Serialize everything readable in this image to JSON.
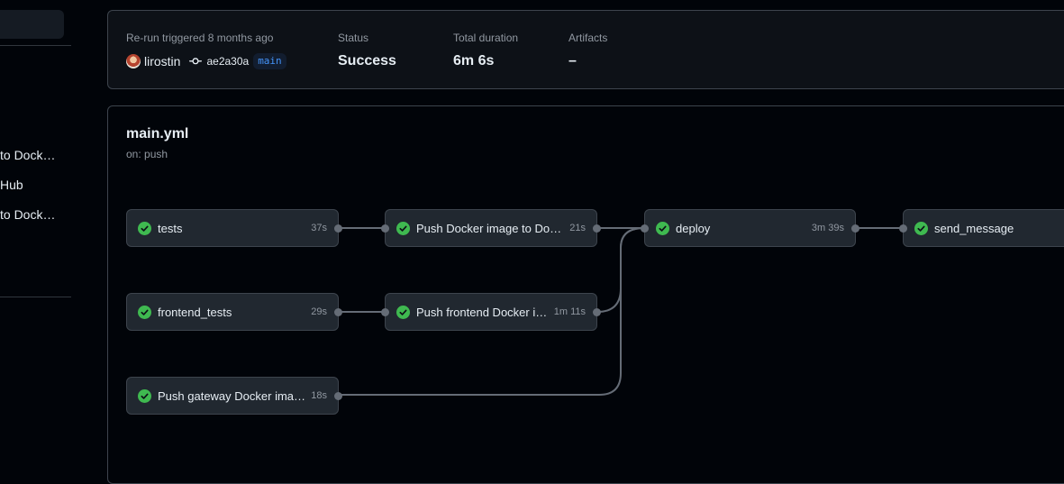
{
  "sidebar": {
    "items": [
      {
        "label": "to Dock…"
      },
      {
        "label": "Hub"
      },
      {
        "label": "to Dock…"
      }
    ]
  },
  "summary": {
    "trigger_label": "Re-run triggered 8 months ago",
    "actor": "lirostin",
    "commit": "ae2a30a",
    "branch": "main",
    "status_label": "Status",
    "status_value": "Success",
    "duration_label": "Total duration",
    "duration_value": "6m 6s",
    "artifacts_label": "Artifacts",
    "artifacts_value": "–"
  },
  "workflow": {
    "name": "main.yml",
    "trigger": "on: push",
    "jobs": [
      {
        "name": "tests",
        "duration": "37s"
      },
      {
        "name": "frontend_tests",
        "duration": "29s"
      },
      {
        "name": "Push gateway Docker image to Docker Hub",
        "duration": "18s"
      },
      {
        "name": "Push Docker image to Docker Hub",
        "duration": "21s"
      },
      {
        "name": "Push frontend Docker image to Docker Hub",
        "duration": "1m 11s"
      },
      {
        "name": "deploy",
        "duration": "3m 39s"
      },
      {
        "name": "send_message",
        "duration": ""
      }
    ]
  },
  "colors": {
    "success": "#3fb950",
    "accent": "#4493f8",
    "connector": "#656c76"
  }
}
